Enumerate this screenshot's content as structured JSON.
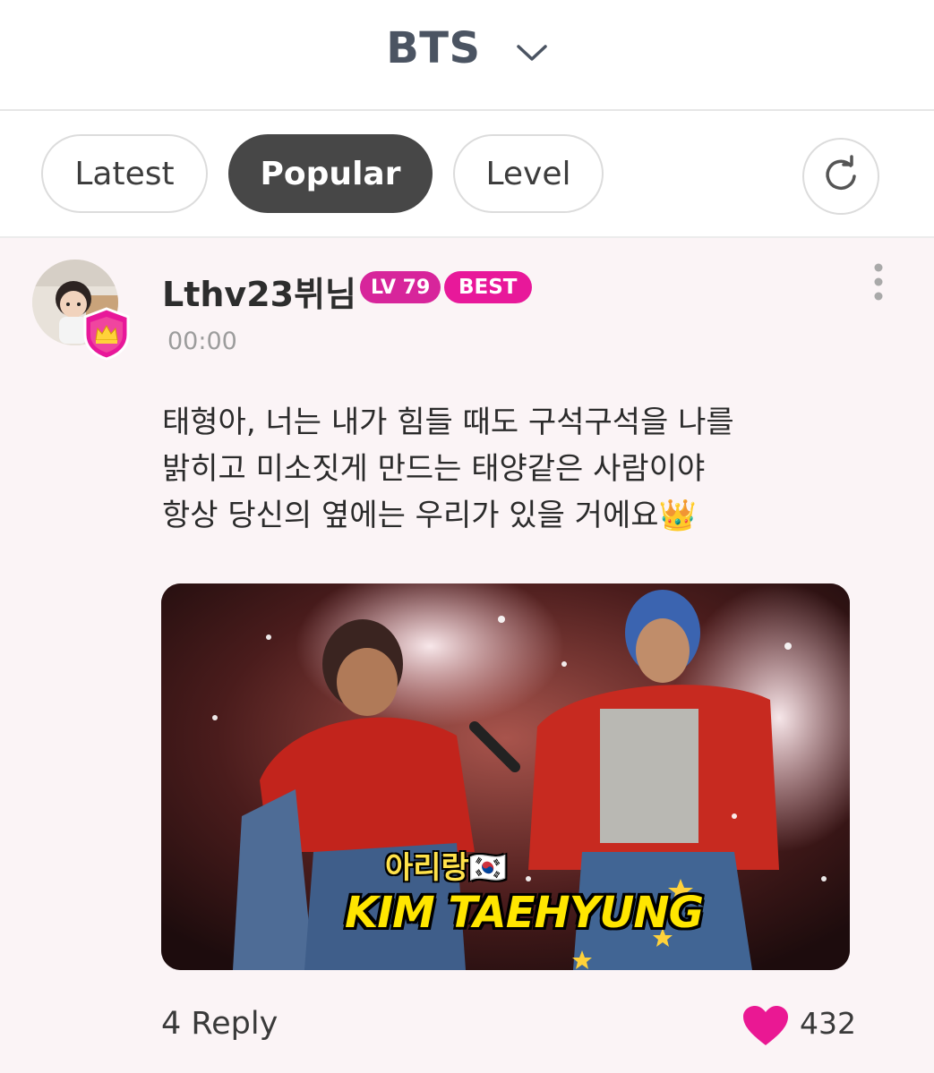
{
  "header": {
    "title": "BTS"
  },
  "tabs": [
    {
      "label": "Latest",
      "active": false
    },
    {
      "label": "Popular",
      "active": true
    },
    {
      "label": "Level",
      "active": false
    }
  ],
  "post": {
    "username": "Lthv23뷔님",
    "level_badge": "LV 79",
    "best_badge": "BEST",
    "time": "00:00",
    "content_lines": [
      "태형아, 너는 내가 힘들 때도 구석구석을 나를",
      "밝히고 미소짓게 만드는 태양같은 사람이야",
      "항상 당신의 옆에는 우리가 있을 거에요👑"
    ],
    "media": {
      "caption_ko": "아리랑🇰🇷",
      "caption_en": "KIM TAEHYUNG"
    },
    "reply_label": "4 Reply",
    "like_count": "432"
  },
  "colors": {
    "accent_pink": "#e8189a",
    "post_background": "#fbf4f6",
    "active_tab": "#474747"
  },
  "icons": [
    "chevron-down-icon",
    "refresh-icon",
    "crown-badge-icon",
    "more-vertical-icon",
    "heart-icon"
  ]
}
